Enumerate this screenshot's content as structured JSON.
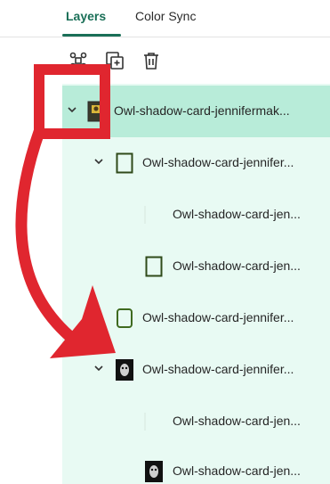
{
  "tabs": [
    {
      "label": "Layers",
      "active": true
    },
    {
      "label": "Color Sync",
      "active": false
    }
  ],
  "toolbar": {
    "icons": [
      "group-layers-icon",
      "duplicate-icon",
      "delete-icon"
    ]
  },
  "accent_color": "#1a6f57",
  "annotation_color": "#e0262f",
  "layers": [
    {
      "label": "Owl-shadow-card-jennifermak...",
      "level": 0,
      "expanded": true,
      "selected": true,
      "thumb": "image-thumbnail"
    },
    {
      "label": "Owl-shadow-card-jennifer...",
      "level": 1,
      "expanded": true,
      "thumb": "outline-thumbnail"
    },
    {
      "label": "Owl-shadow-card-jen...",
      "level": 2,
      "thumb": "blank-thumbnail"
    },
    {
      "label": "Owl-shadow-card-jen...",
      "level": 2,
      "thumb": "outline-thumbnail"
    },
    {
      "label": "Owl-shadow-card-jennifer...",
      "level": 1,
      "thumb": "rounded-outline-thumbnail"
    },
    {
      "label": "Owl-shadow-card-jennifer...",
      "level": 1,
      "expanded": true,
      "thumb": "owl-image-thumbnail"
    },
    {
      "label": "Owl-shadow-card-jen...",
      "level": 2,
      "thumb": "blank-thumbnail"
    },
    {
      "label": "Owl-shadow-card-jen...",
      "level": 2,
      "thumb": "owl-image-thumbnail"
    }
  ]
}
